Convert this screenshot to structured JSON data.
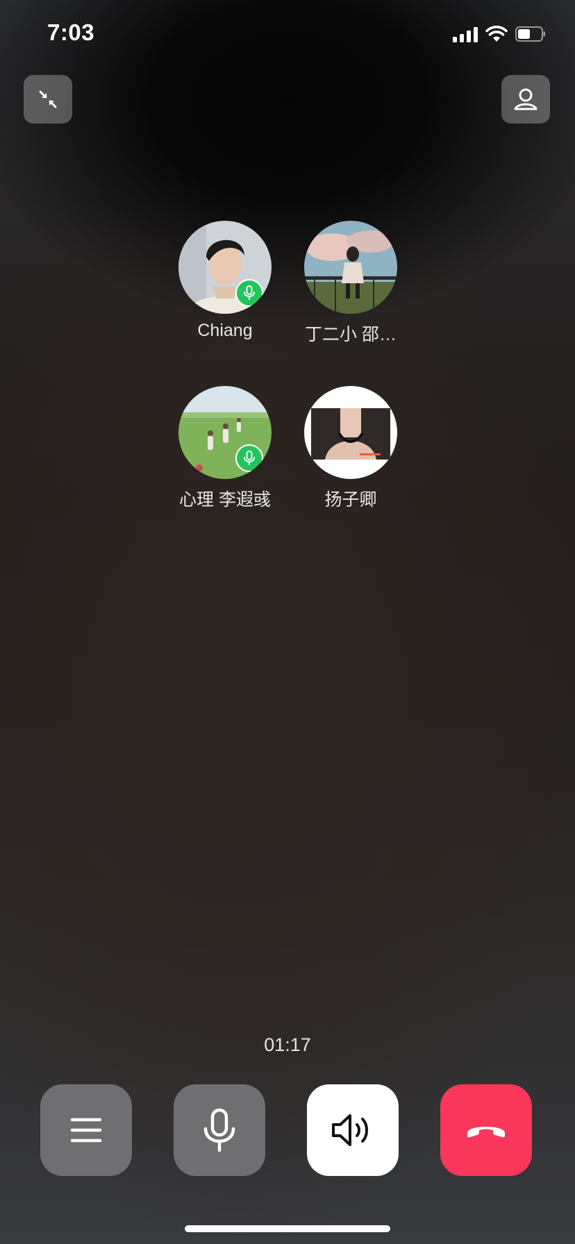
{
  "status_bar": {
    "time": "7:03"
  },
  "participants": [
    {
      "name": "Chiang",
      "avatar": "young-man-portrait",
      "mic_active": true
    },
    {
      "name": "丁二小  邵…",
      "avatar": "girl-sitting-on-railing-clouds",
      "mic_active": false
    },
    {
      "name": "心理 李遐彧",
      "avatar": "children-running-in-field",
      "mic_active": true
    },
    {
      "name": "扬子卿",
      "avatar": "woman-with-choker-photo",
      "mic_active": false
    }
  ],
  "call": {
    "duration": "01:17"
  },
  "controls": {
    "menu": "menu-icon",
    "mic": "microphone-icon",
    "speaker": "speaker-icon",
    "hangup": "hang-up-icon"
  },
  "colors": {
    "mic_badge": "#21c45d",
    "hangup": "#f8375a",
    "speaker_bg": "#ffffff",
    "control_bg": "#6f6f71"
  }
}
